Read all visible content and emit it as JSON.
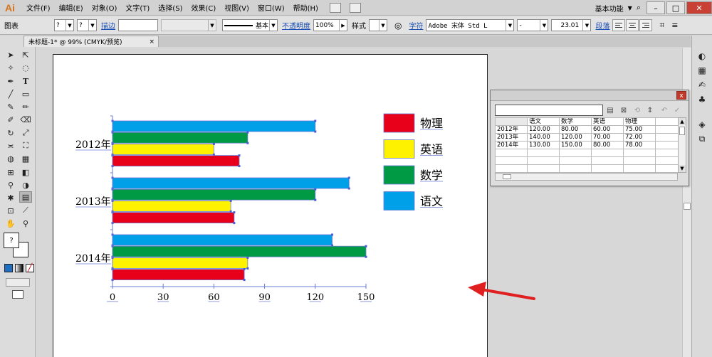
{
  "app": {
    "logo": "Ai"
  },
  "menu": [
    "文件(F)",
    "编辑(E)",
    "对象(O)",
    "文字(T)",
    "选择(S)",
    "效果(C)",
    "视图(V)",
    "窗口(W)",
    "帮助(H)"
  ],
  "workspace": {
    "label": "基本功能",
    "dropdown_icon": "chevron-down-icon"
  },
  "window_controls": {
    "minimize": "–",
    "maximize": "□",
    "close": "✕"
  },
  "control_bar": {
    "object_type": "图表",
    "fill_value": "?",
    "stroke_value": "?",
    "stroke_label": "描边",
    "stroke_style": "基本",
    "opacity_label": "不透明度",
    "opacity_value": "100%",
    "style_label": "样式",
    "char_label": "字符",
    "font_family": "Adobe 宋体 Std L",
    "font_style": "-",
    "font_size": "23.01",
    "para_label": "段落"
  },
  "document_tab": {
    "title": "未标题-1* @ 99% (CMYK/预览)",
    "close": "×"
  },
  "chart_data": {
    "type": "bar",
    "orientation": "horizontal",
    "categories": [
      "2012年",
      "2013年",
      "2014年"
    ],
    "series": [
      {
        "name": "物理",
        "color": "#e8001a",
        "values": [
          75,
          72,
          78
        ]
      },
      {
        "name": "英语",
        "color": "#fff200",
        "values": [
          60,
          70,
          80
        ]
      },
      {
        "name": "数学",
        "color": "#009a44",
        "values": [
          80,
          120,
          150
        ]
      },
      {
        "name": "语文",
        "color": "#00a0e9",
        "values": [
          120,
          140,
          130
        ]
      }
    ],
    "x_ticks": [
      0,
      30,
      60,
      90,
      120,
      150
    ],
    "xlim": [
      0,
      150
    ],
    "legend_position": "right",
    "grid": false
  },
  "data_window": {
    "input_value": "",
    "close_label": "x",
    "headers": [
      "",
      "语文",
      "数学",
      "英语",
      "物理",
      ""
    ],
    "rows": [
      [
        "2012年",
        "120.00",
        "80.00",
        "60.00",
        "75.00",
        ""
      ],
      [
        "2013年",
        "140.00",
        "120.00",
        "70.00",
        "72.00",
        ""
      ],
      [
        "2014年",
        "130.00",
        "150.00",
        "80.00",
        "78.00",
        ""
      ],
      [
        "",
        "",
        "",
        "",
        "",
        ""
      ],
      [
        "",
        "",
        "",
        "",
        "",
        ""
      ],
      [
        "",
        "",
        "",
        "",
        "",
        ""
      ]
    ]
  }
}
